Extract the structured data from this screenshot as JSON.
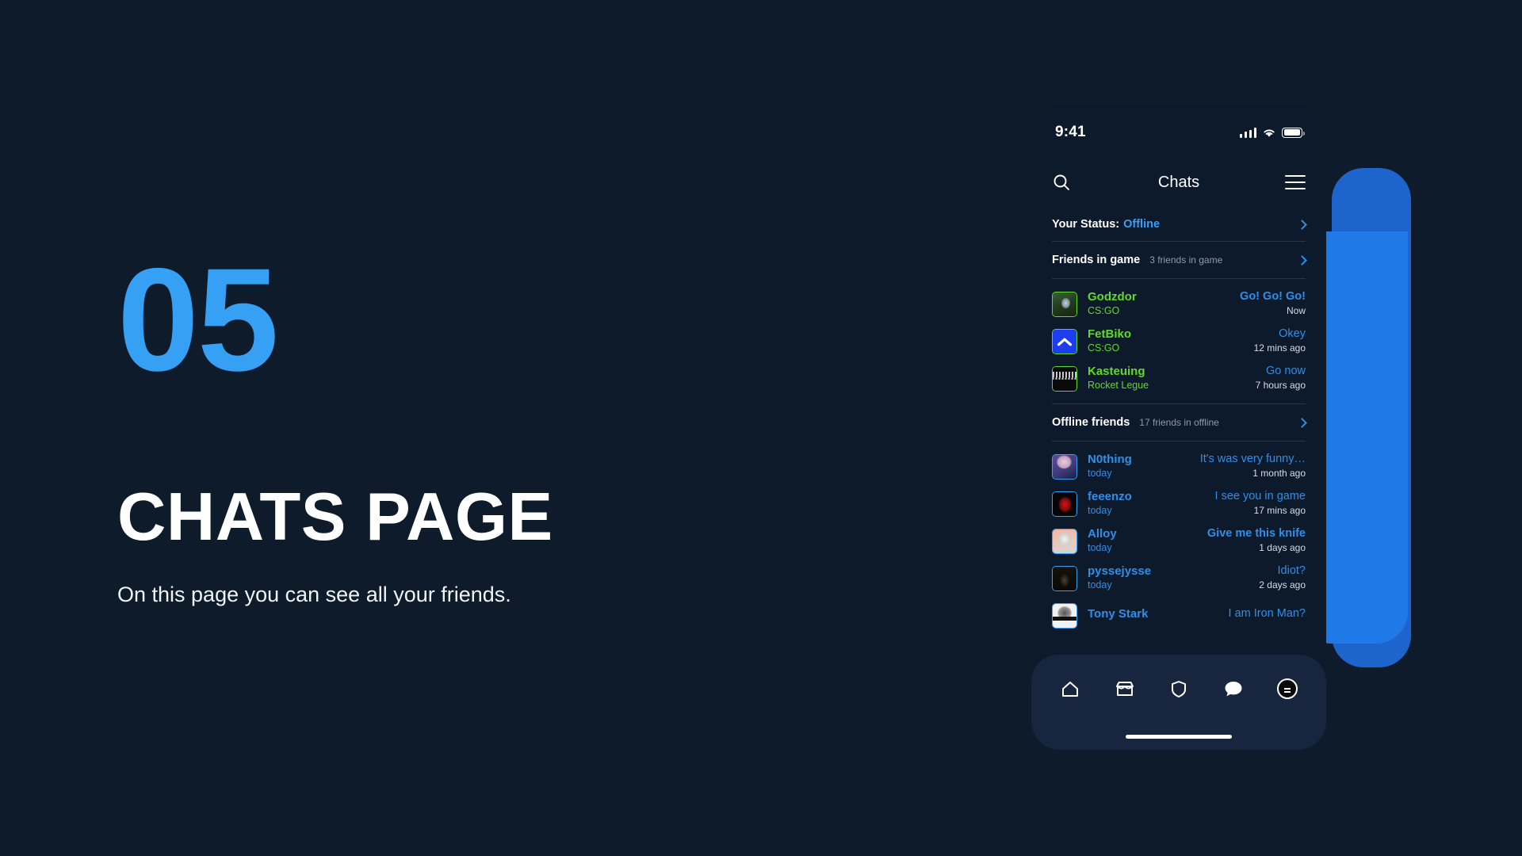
{
  "slide": {
    "number": "05",
    "title": "CHATS PAGE",
    "subtitle": "On this page you can see all your friends."
  },
  "colors": {
    "background": "#0e1b2a",
    "accent_blue": "#35a0f4",
    "online_green": "#62d92a",
    "link_blue": "#2f8ee8",
    "deco_blue_front": "#1f7ae8",
    "deco_blue_back": "#1d64cc",
    "phone_bg": "#0d1a2b",
    "navbar_bg": "#17263e"
  },
  "phone": {
    "status_bar": {
      "time": "9:41",
      "signal_icon": "cellular-signal-icon",
      "wifi_icon": "wifi-icon",
      "battery_icon": "battery-full-icon"
    },
    "app_bar": {
      "title": "Chats",
      "search_icon": "search-icon",
      "menu_icon": "hamburger-menu-icon"
    },
    "status_row": {
      "label": "Your Status:",
      "value": "Offline",
      "chevron_icon": "chevron-right-icon"
    },
    "sections": [
      {
        "title": "Friends in game",
        "count_label": "3 friends in game",
        "chevron_icon": "chevron-right-icon"
      },
      {
        "title": "Offline friends",
        "count_label": "17 friends in offline",
        "chevron_icon": "chevron-right-icon"
      }
    ],
    "friends_in_game": [
      {
        "name": "Godzdor",
        "sub": "CS:GO",
        "message": "Go! Go! Go!",
        "time": "Now",
        "message_bold": true,
        "avatar": "avatar-godzdor"
      },
      {
        "name": "FetBiko",
        "sub": "CS:GO",
        "message": "Okey",
        "time": "12 mins ago",
        "message_bold": false,
        "avatar": "avatar-fetbiko"
      },
      {
        "name": "Kasteuing",
        "sub": "Rocket Legue",
        "message": "Go now",
        "time": "7 hours ago",
        "message_bold": false,
        "avatar": "avatar-kasteuing"
      }
    ],
    "offline_friends": [
      {
        "name": "N0thing",
        "sub": "today",
        "message": "It's was very funny…",
        "time": "1 month ago",
        "message_bold": false,
        "avatar": "avatar-n0thing"
      },
      {
        "name": "feeenzo",
        "sub": "today",
        "message": "I see you in game",
        "time": "17 mins ago",
        "message_bold": false,
        "avatar": "avatar-feeenzo"
      },
      {
        "name": "Alloy",
        "sub": "today",
        "message": "Give me this knife",
        "time": "1 days ago",
        "message_bold": true,
        "avatar": "avatar-alloy"
      },
      {
        "name": "pyssejysse",
        "sub": "today",
        "message": "Idiot?",
        "time": "2 days ago",
        "message_bold": false,
        "avatar": "avatar-pyssejysse"
      },
      {
        "name": "Tony Stark",
        "sub": "",
        "message": "I am Iron Man?",
        "time": "",
        "message_bold": false,
        "avatar": "avatar-tony-stark"
      }
    ],
    "bottom_nav": [
      {
        "icon": "home-icon",
        "active": false
      },
      {
        "icon": "store-icon",
        "active": false
      },
      {
        "icon": "shield-icon",
        "active": false
      },
      {
        "icon": "chat-bubble-icon",
        "active": true
      },
      {
        "icon": "coin-icon",
        "active": false
      }
    ]
  }
}
